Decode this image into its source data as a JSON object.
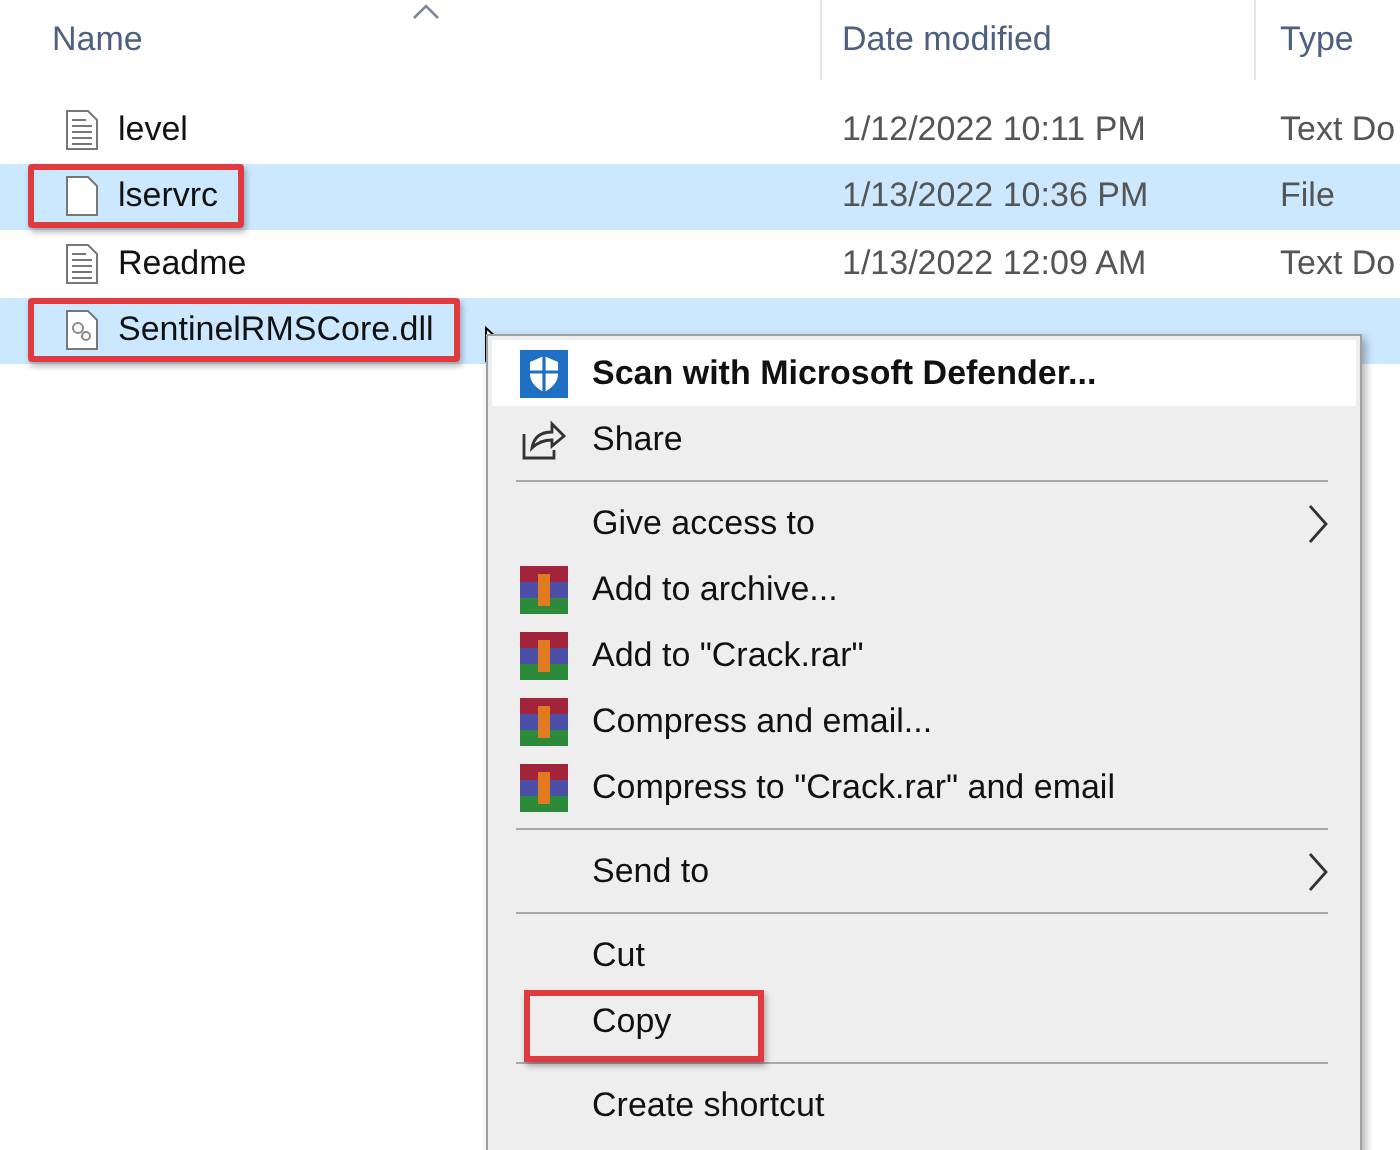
{
  "columns": [
    {
      "label": "Name",
      "sorted": true
    },
    {
      "label": "Date modified",
      "sorted": false
    },
    {
      "label": "Type",
      "sorted": false
    }
  ],
  "rows": [
    {
      "name": "level",
      "date": "1/12/2022 10:11 PM",
      "type": "Text Do",
      "kind": "document",
      "selected": false,
      "highlighted": false
    },
    {
      "name": "lservrc",
      "date": "1/13/2022 10:36 PM",
      "type": "File",
      "kind": "file",
      "selected": true,
      "highlighted": true
    },
    {
      "name": "Readme",
      "date": "1/13/2022 12:09 AM",
      "type": "Text Do",
      "kind": "document",
      "selected": false,
      "highlighted": false
    },
    {
      "name": "SentinelRMSCore.dll",
      "kind": "library",
      "selected": true,
      "highlighted": true
    }
  ],
  "context_menu": {
    "items": [
      {
        "kind": "defender",
        "label": "Scan with Microsoft Defender...",
        "bold": true,
        "submenu": false,
        "selected": true,
        "highlighted": false
      },
      {
        "kind": "share",
        "label": "Share",
        "bold": false,
        "submenu": false,
        "selected": false,
        "highlighted": false
      },
      {
        "kind": "separator"
      },
      {
        "kind": "plain",
        "label": "Give access to",
        "bold": false,
        "submenu": true,
        "selected": false,
        "highlighted": false
      },
      {
        "kind": "archive",
        "label": "Add to archive...",
        "bold": false,
        "submenu": false,
        "selected": false,
        "highlighted": false
      },
      {
        "kind": "archive",
        "label": "Add to \"Crack.rar\"",
        "bold": false,
        "submenu": false,
        "selected": false,
        "highlighted": false
      },
      {
        "kind": "archive",
        "label": "Compress and email...",
        "bold": false,
        "submenu": false,
        "selected": false,
        "highlighted": false
      },
      {
        "kind": "archive",
        "label": "Compress to \"Crack.rar\" and email",
        "bold": false,
        "submenu": false,
        "selected": false,
        "highlighted": false
      },
      {
        "kind": "separator"
      },
      {
        "kind": "plain",
        "label": "Send to",
        "bold": false,
        "submenu": true,
        "selected": false,
        "highlighted": false
      },
      {
        "kind": "separator"
      },
      {
        "kind": "plain",
        "label": "Cut",
        "bold": false,
        "submenu": false,
        "selected": false,
        "highlighted": false
      },
      {
        "kind": "plain",
        "label": "Copy",
        "bold": false,
        "submenu": false,
        "selected": false,
        "highlighted": true
      },
      {
        "kind": "separator"
      },
      {
        "kind": "plain",
        "label": "Create shortcut",
        "bold": false,
        "submenu": false,
        "selected": false,
        "highlighted": false
      }
    ]
  }
}
